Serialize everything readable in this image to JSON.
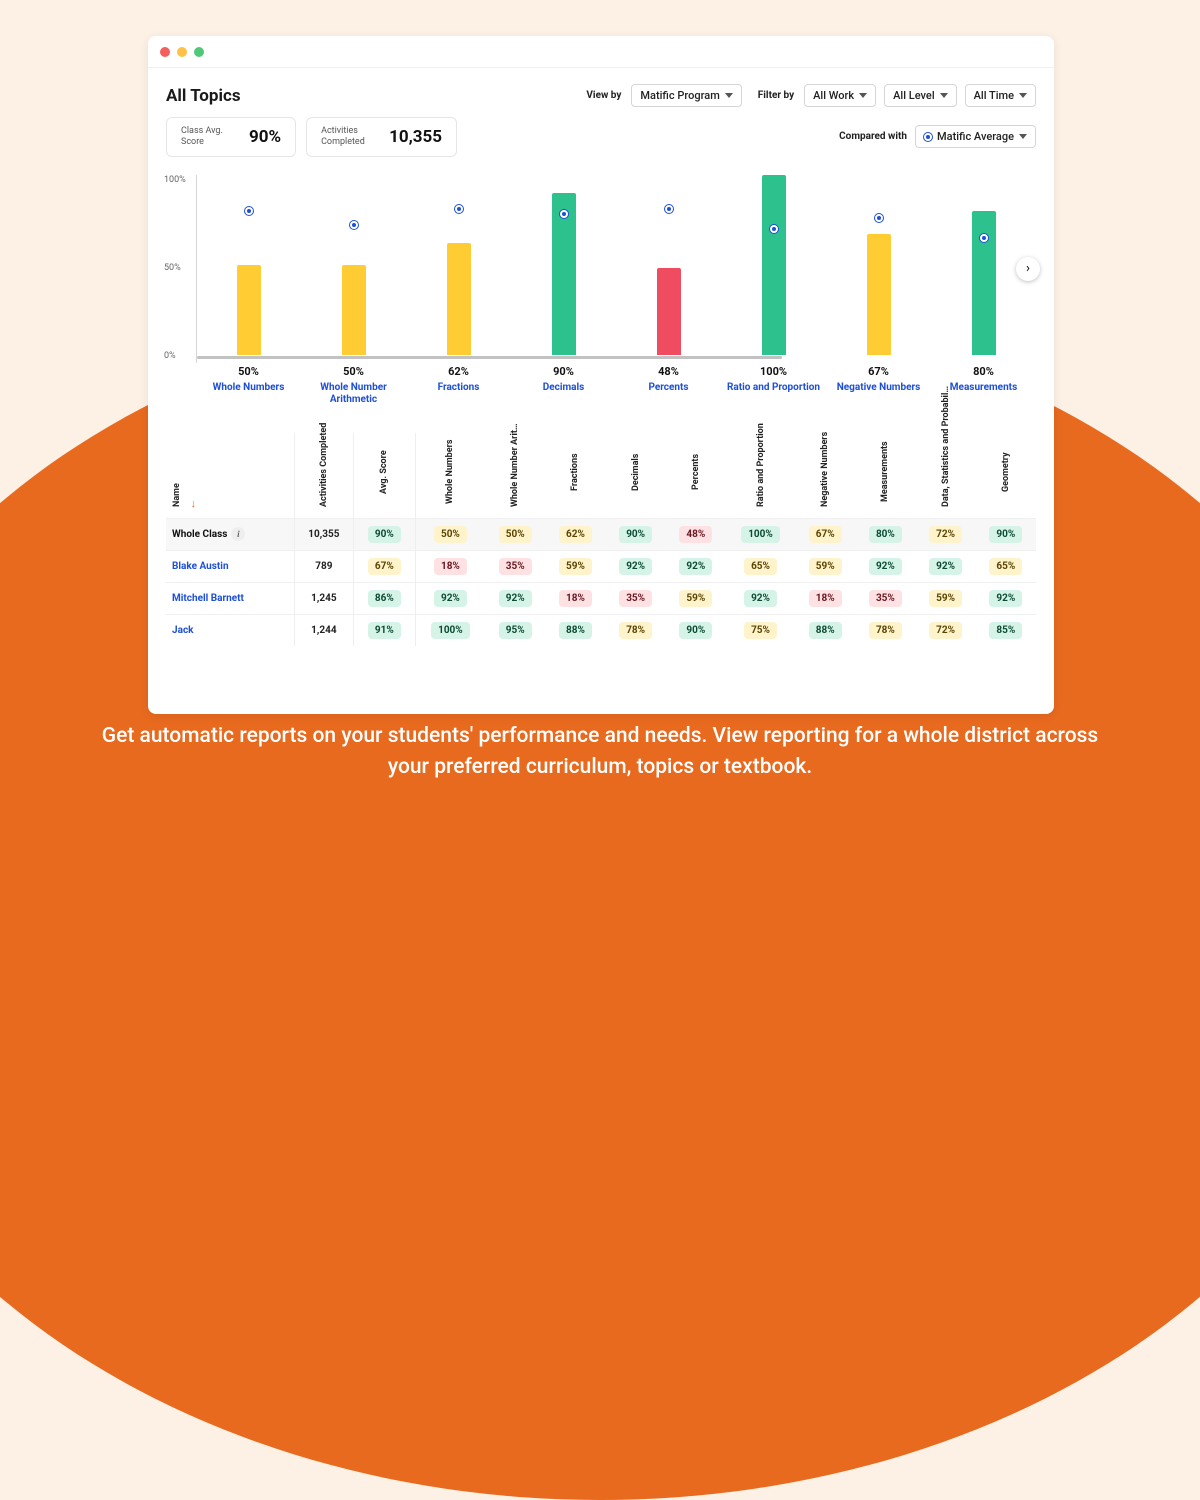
{
  "caption": "Get automatic reports on your students' performance and needs. View reporting for a whole district across your preferred curriculum, topics or textbook.",
  "page": {
    "title": "All Topics"
  },
  "controls": {
    "view_by_label": "View by",
    "view_by_value": "Matific Program",
    "filter_by_label": "Filter by",
    "filter_work": "All Work",
    "filter_level": "All Level",
    "filter_time": "All Time",
    "compare_label": "Compared with",
    "compare_value": "Matific Average"
  },
  "cards": {
    "score_label": "Class Avg. Score",
    "score_value": "90%",
    "activities_label": "Activities Completed",
    "activities_value": "10,355"
  },
  "axis": {
    "y100": "100%",
    "y50": "50%",
    "y0": "0%"
  },
  "chart_data": {
    "type": "bar",
    "ylabel": "",
    "ylim": [
      0,
      100
    ],
    "categories": [
      "Whole Numbers",
      "Whole Number Arithmetic",
      "Fractions",
      "Decimals",
      "Percents",
      "Ratio and Proportion",
      "Negative Numbers",
      "Measurements"
    ],
    "series": [
      {
        "name": "Class Avg. Score",
        "values": [
          50,
          50,
          62,
          90,
          48,
          100,
          67,
          80
        ],
        "colors": [
          "yellow",
          "yellow",
          "yellow",
          "green",
          "red",
          "green",
          "yellow",
          "green"
        ]
      },
      {
        "name": "Matific Average",
        "values": [
          80,
          72,
          81,
          78,
          81,
          70,
          76,
          65
        ]
      }
    ]
  },
  "table": {
    "columns": [
      "Name",
      "Activities Completed",
      "Avg. Score",
      "Whole Numbers",
      "Whole Number Arit…",
      "Fractions",
      "Decimals",
      "Percents",
      "Ratio and Proportion",
      "Negative Numbers",
      "Measurements",
      "Data, Statistics and Probabil…",
      "Geometry"
    ],
    "rows": [
      {
        "name": "Whole Class",
        "whole": true,
        "activities": "10,355",
        "avg": "90%",
        "scores": [
          50,
          50,
          62,
          90,
          48,
          100,
          67,
          80,
          72,
          90
        ]
      },
      {
        "name": "Blake Austin",
        "activities": "789",
        "avg": "67%",
        "scores": [
          18,
          35,
          59,
          92,
          92,
          65,
          59,
          92,
          92,
          65
        ]
      },
      {
        "name": "Mitchell Barnett",
        "activities": "1,245",
        "avg": "86%",
        "scores": [
          92,
          92,
          18,
          35,
          59,
          92,
          18,
          35,
          59,
          92
        ]
      },
      {
        "name": "Jack",
        "activities": "1,244",
        "avg": "91%",
        "scores": [
          100,
          95,
          88,
          78,
          90,
          75,
          88,
          78,
          72,
          85
        ]
      }
    ]
  }
}
